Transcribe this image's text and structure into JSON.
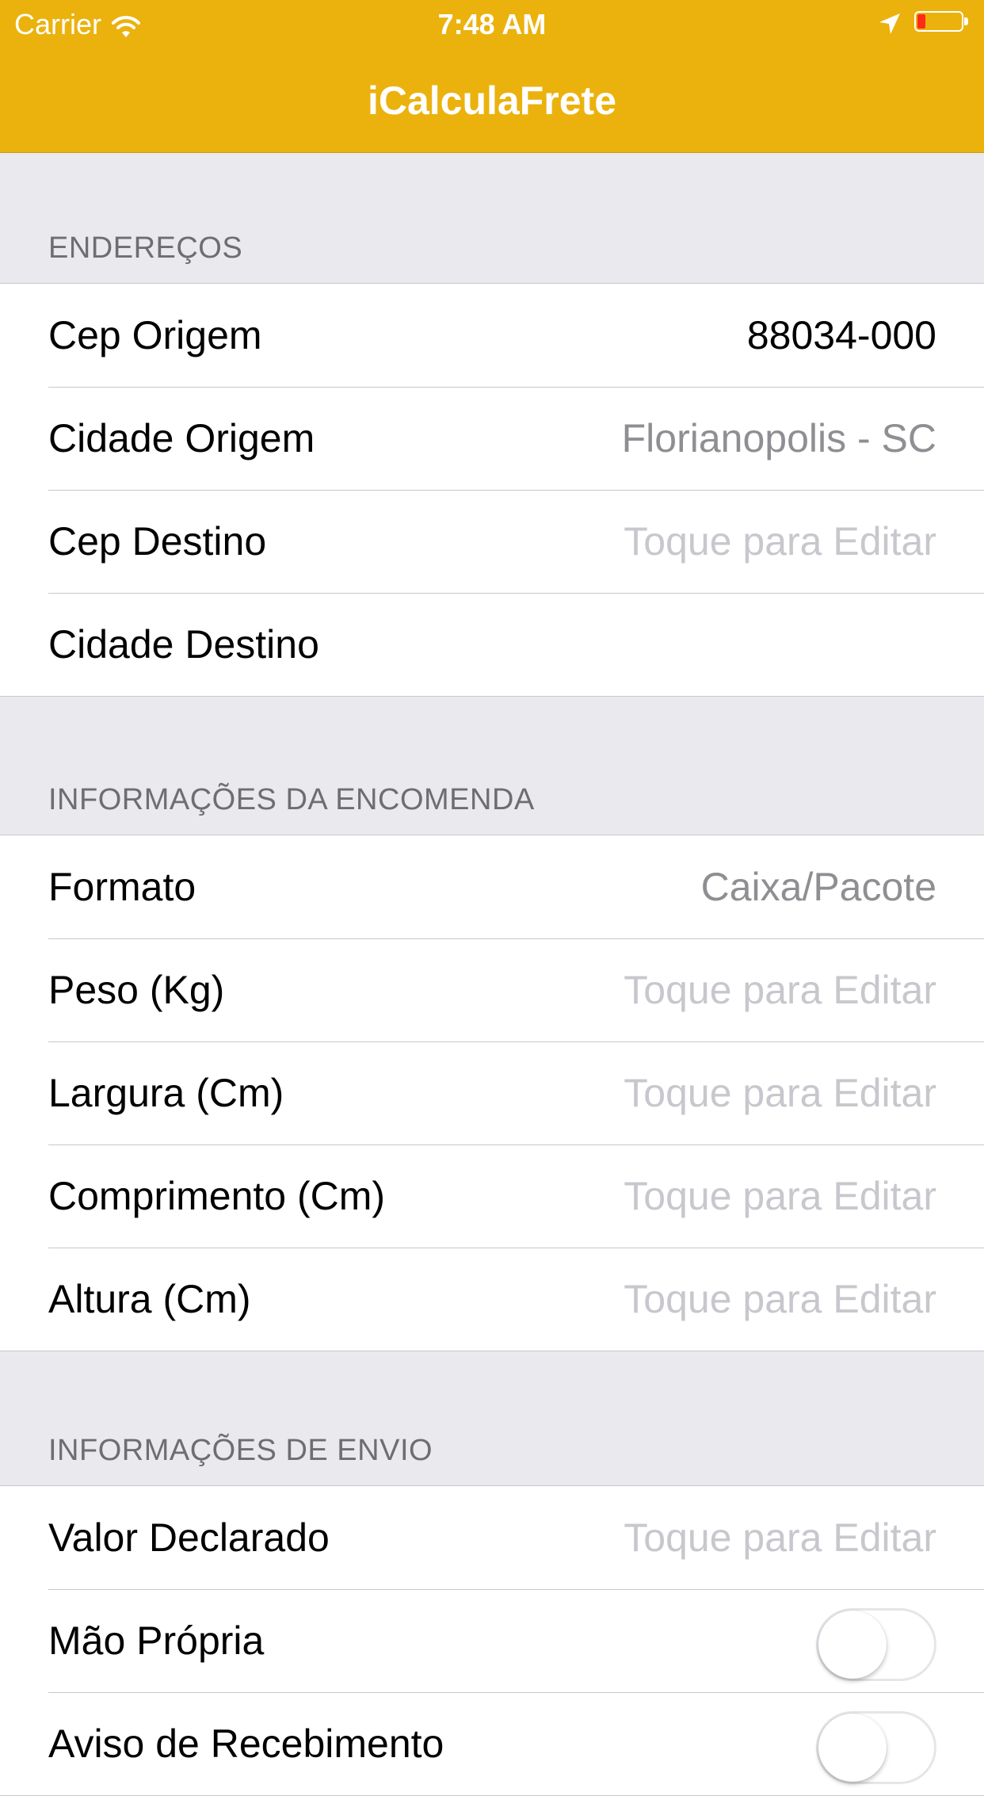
{
  "status_bar": {
    "carrier": "Carrier",
    "time": "7:48 AM"
  },
  "nav": {
    "title": "iCalculaFrete"
  },
  "colors": {
    "nav_background": "#ebb20e",
    "group_background": "#e9e9ee",
    "placeholder": "#c7c7cd",
    "secondary_value": "#8e8e93"
  },
  "sections": {
    "enderecos": {
      "header": "ENDEREÇOS",
      "rows": [
        {
          "label": "Cep Origem",
          "value": "88034-000"
        },
        {
          "label": "Cidade Origem",
          "value": "Florianopolis - SC"
        },
        {
          "label": "Cep Destino",
          "placeholder": "Toque para Editar"
        },
        {
          "label": "Cidade Destino",
          "value": ""
        }
      ]
    },
    "encomenda": {
      "header": "INFORMAÇÕES DA ENCOMENDA",
      "rows": [
        {
          "label": "Formato",
          "value": "Caixa/Pacote"
        },
        {
          "label": "Peso (Kg)",
          "placeholder": "Toque para Editar"
        },
        {
          "label": "Largura (Cm)",
          "placeholder": "Toque para Editar"
        },
        {
          "label": "Comprimento (Cm)",
          "placeholder": "Toque para Editar"
        },
        {
          "label": "Altura (Cm)",
          "placeholder": "Toque para Editar"
        }
      ]
    },
    "envio": {
      "header": "INFORMAÇÕES DE ENVIO",
      "rows": [
        {
          "label": "Valor Declarado",
          "placeholder": "Toque para Editar"
        },
        {
          "label": "Mão Própria",
          "switch_on": false
        },
        {
          "label": "Aviso de Recebimento",
          "switch_on": false
        }
      ]
    }
  }
}
